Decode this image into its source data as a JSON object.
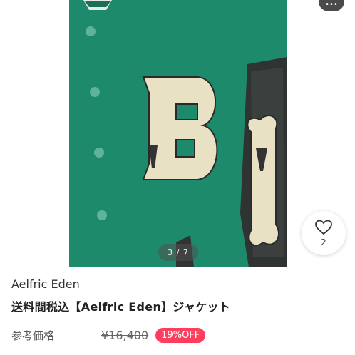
{
  "gallery": {
    "image_counter": "3 / 7",
    "favorite_count": "2"
  },
  "product": {
    "brand": "Aelfric Eden",
    "title": "送料間税込【Aelfric Eden】ジャケット"
  },
  "price": {
    "label": "参考価格",
    "original": "¥16,400",
    "discount": "19%OFF"
  },
  "colors": {
    "jacket": "#1d8a6c",
    "discount_badge": "#ff3d5c"
  }
}
